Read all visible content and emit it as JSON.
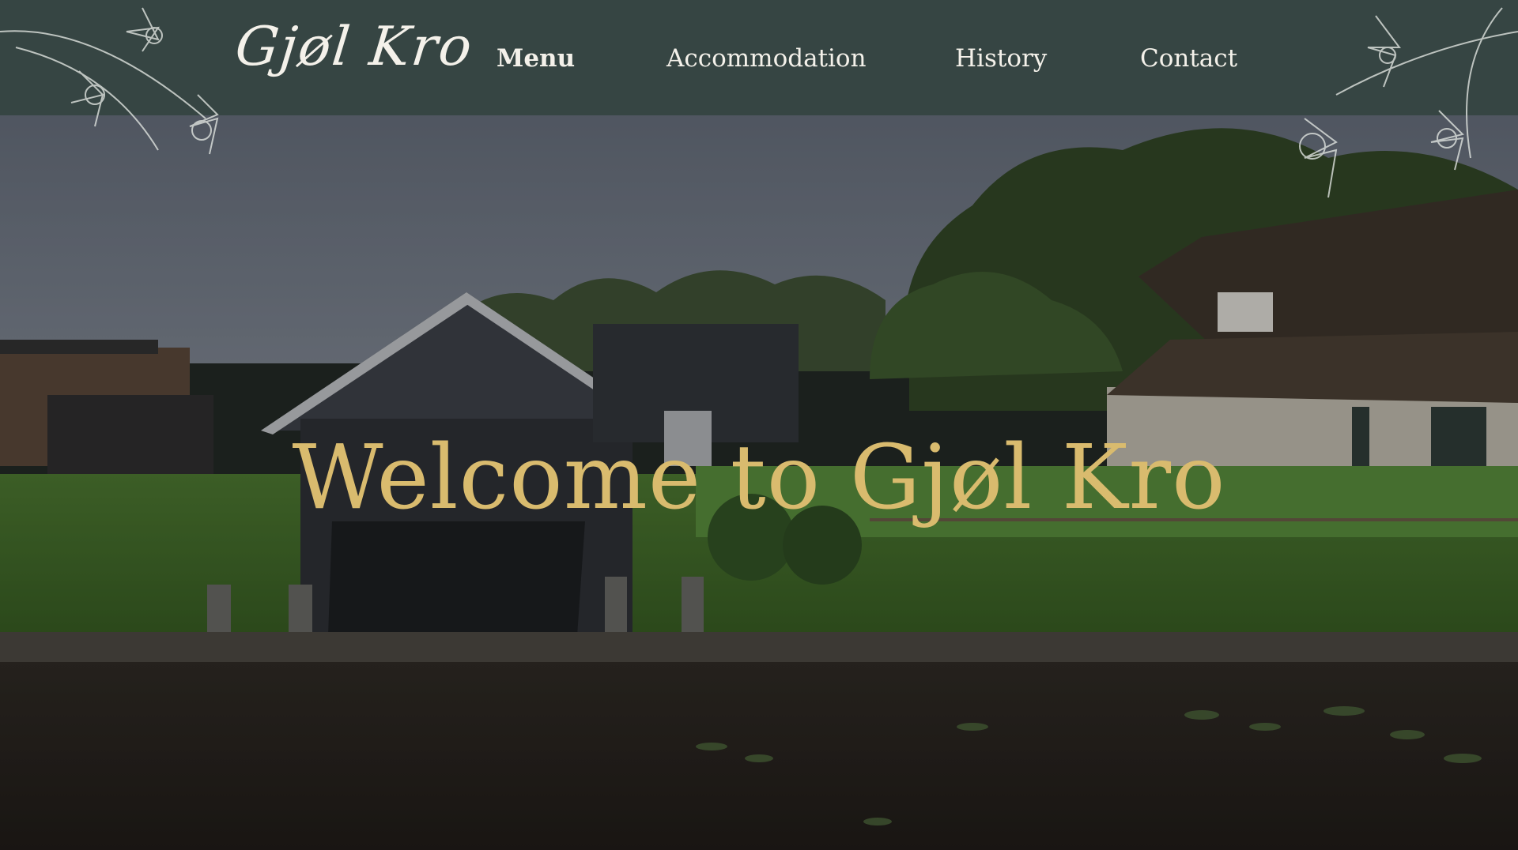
{
  "header": {
    "logo_text": "Gjøl Kro",
    "nav": [
      {
        "label": "Menu",
        "active": true
      },
      {
        "label": "Accommodation",
        "active": false
      },
      {
        "label": "History",
        "active": false
      },
      {
        "label": "Contact",
        "active": false
      }
    ],
    "background_color": "#364543"
  },
  "hero": {
    "title": "Welcome to Gjøl Kro",
    "title_color": "#d9bb6e",
    "image_description_icon": "photo-canal-boathouse"
  }
}
